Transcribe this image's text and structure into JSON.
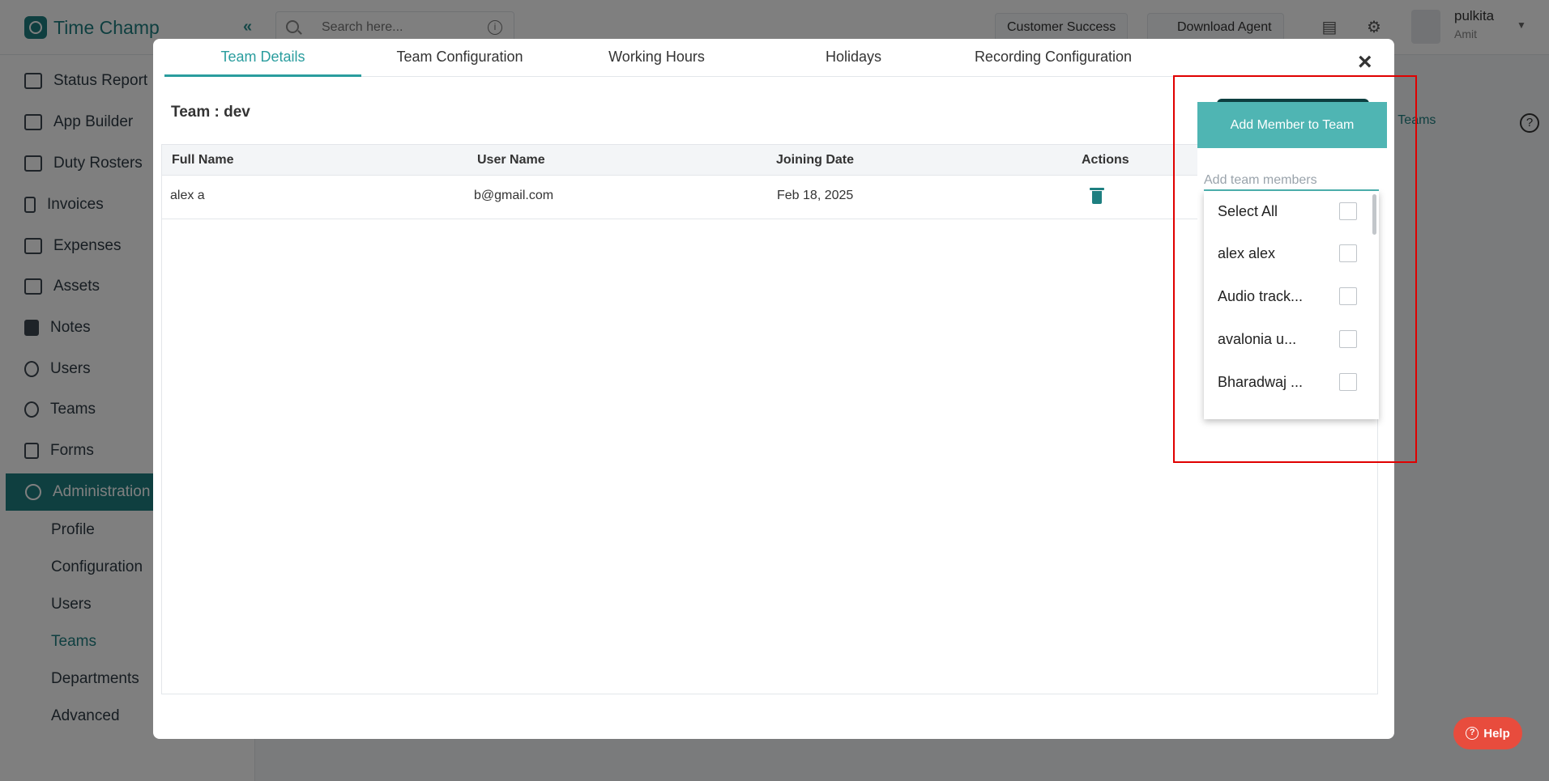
{
  "app": {
    "logo_text": "Time Champ",
    "collapse_label": "«",
    "search_placeholder": "Search here...",
    "top_buttons": [
      "Customer Success",
      "Download Agent"
    ],
    "user": {
      "name": "pulkita",
      "subtitle": "Amit"
    }
  },
  "sidebar": {
    "items": [
      {
        "label": "Status Report",
        "icon": "status-report-icon"
      },
      {
        "label": "App Builder",
        "icon": "app-builder-icon"
      },
      {
        "label": "Duty Rosters",
        "icon": "duty-rosters-icon"
      },
      {
        "label": "Invoices",
        "icon": "invoices-icon"
      },
      {
        "label": "Expenses",
        "icon": "expenses-icon"
      },
      {
        "label": "Assets",
        "icon": "assets-icon"
      },
      {
        "label": "Notes",
        "icon": "notes-icon"
      },
      {
        "label": "Users",
        "icon": "users-icon"
      },
      {
        "label": "Teams",
        "icon": "teams-icon"
      },
      {
        "label": "Forms",
        "icon": "forms-icon"
      },
      {
        "label": "Administration",
        "icon": "gear-icon"
      }
    ],
    "sub_items": [
      "Profile",
      "Configuration",
      "Users",
      "Teams",
      "Departments",
      "Advanced"
    ]
  },
  "page": {
    "inactive_teams_link": "w Inactive Teams"
  },
  "modal": {
    "tabs": [
      "Team Details",
      "Team Configuration",
      "Working Hours",
      "Holidays",
      "Recording Configuration"
    ],
    "close_label": "×",
    "team_title": "Team : dev",
    "columns": [
      "Full Name",
      "User Name",
      "Joining Date",
      "Actions"
    ],
    "rows": [
      {
        "full_name": "alex a",
        "user_name": "b@gmail.com",
        "joining_date": "Feb 18, 2025"
      }
    ]
  },
  "add_member": {
    "header": "Add Member to Team",
    "input_placeholder": "Add team members",
    "options": [
      "Select All",
      "alex alex",
      "Audio track...",
      "avalonia u...",
      "Bharadwaj ..."
    ]
  },
  "help_button": "Help",
  "colors": {
    "brand": "#1e7f80",
    "accent": "#4fb5b3",
    "highlight": "#e00000",
    "help": "#e84c3d"
  }
}
